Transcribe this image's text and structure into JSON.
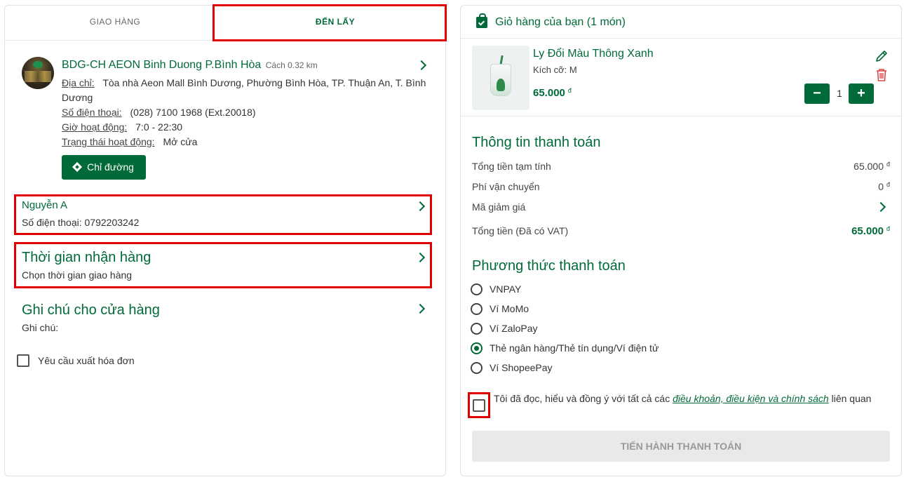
{
  "tabs": [
    {
      "label": "GIAO HÀNG"
    },
    {
      "label": "ĐẾN LẤY"
    }
  ],
  "store": {
    "name": "BDG-CH AEON Binh Duong P.Bình Hòa",
    "distance": "Cách 0.32 km",
    "address_label": "Địa chỉ:",
    "address_line1": "Tòa nhà Aeon Mall Bình Dương, Phường Bình Hòa, TP. Thuận An, T. Bình",
    "address_line2": "Dương",
    "phone_label": "Số điện thoại:",
    "phone": "(028) 7100 1968 (Ext.20018)",
    "hours_label": "Giờ hoạt động:",
    "hours": "7:0 - 22:30",
    "status_label": "Trạng thái hoạt động:",
    "status": "Mở cửa",
    "directions_label": "Chỉ đường"
  },
  "customer": {
    "name": "Nguyễn A",
    "phone_text": "Số điện thoại: 0792203242"
  },
  "pickup_time": {
    "title": "Thời gian nhận hàng",
    "subtitle": "Chọn thời gian giao hàng"
  },
  "note": {
    "title": "Ghi chú cho cửa hàng",
    "label": "Ghi chú:"
  },
  "invoice": {
    "label": "Yêu cầu xuất hóa đơn"
  },
  "cart": {
    "title": "Giỏ hàng của bạn (1 món)",
    "item": {
      "name": "Ly Đổi Màu Thông Xanh",
      "size": "Kích cỡ: M",
      "price": "65.000",
      "currency": "đ",
      "quantity": "1",
      "minus": "−",
      "plus": "+"
    }
  },
  "payment_info": {
    "title": "Thông tin thanh toán",
    "subtotal_label": "Tổng tiền tạm tính",
    "subtotal": "65.000",
    "shipping_label": "Phí vận chuyển",
    "shipping": "0",
    "discount_label": "Mã giảm giá",
    "total_label": "Tổng tiền (Đã có VAT)",
    "total": "65.000",
    "currency": "đ"
  },
  "payment_methods": {
    "title": "Phương thức thanh toán",
    "options": [
      "VNPAY",
      "Ví MoMo",
      "Ví ZaloPay",
      "Thẻ ngân hàng/Thẻ tín dụng/Ví điện tử",
      "Ví ShopeePay"
    ],
    "selected_index": 3
  },
  "terms": {
    "prefix": "Tôi đã đọc, hiểu và đồng ý với tất cả các",
    "link": "điều khoản, điều kiện và chính sách",
    "suffix": "liên quan"
  },
  "checkout_label": "TIẾN HÀNH THANH TOÁN",
  "colors": {
    "brand": "#006a38",
    "highlight": "#e00000"
  }
}
